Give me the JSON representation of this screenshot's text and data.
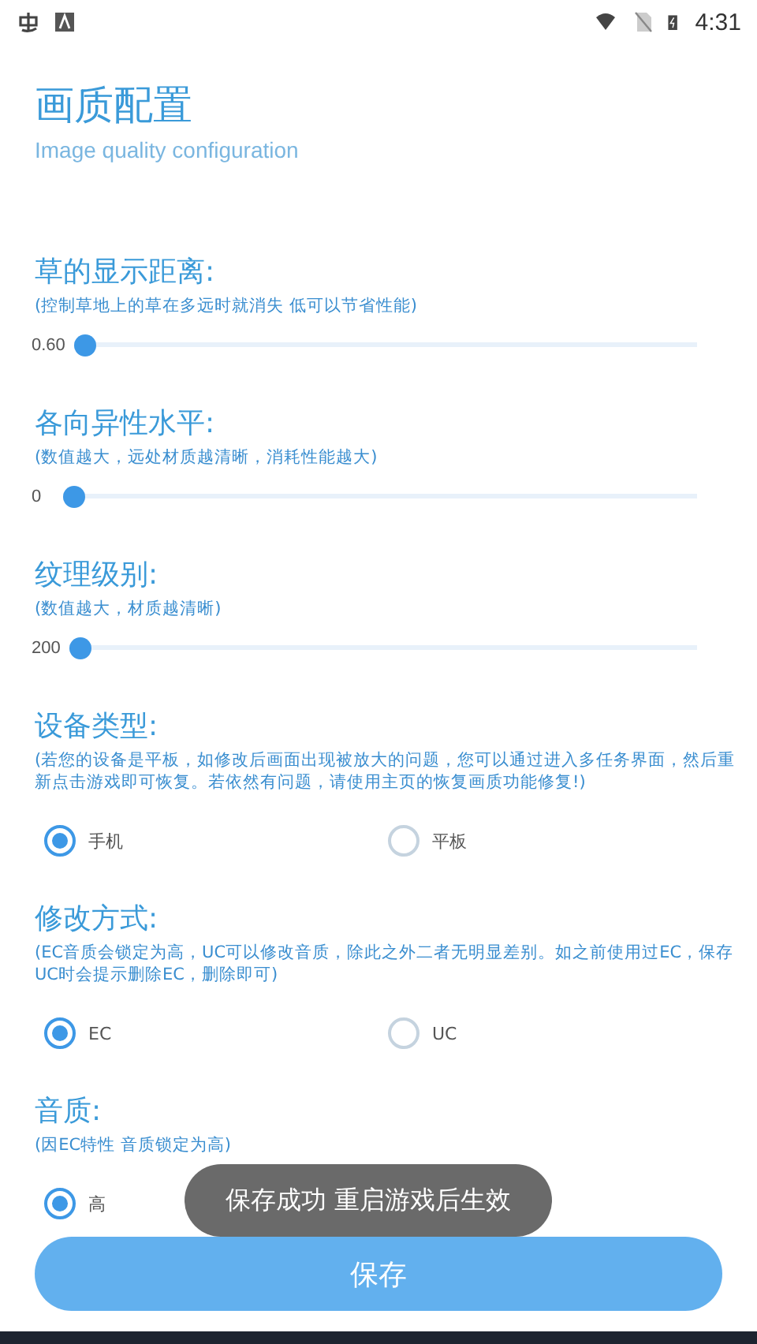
{
  "status_bar": {
    "time": "4:31"
  },
  "header": {
    "title": "画质配置",
    "subtitle": "Image quality configuration"
  },
  "sections": [
    {
      "kind": "slider",
      "title": "草的显示距离:",
      "hint": "(控制草地上的草在多远时就消失 低可以节省性能)",
      "reading": "0.60",
      "level": 0
    },
    {
      "kind": "slider",
      "title": "各向异性水平:",
      "hint": "(数值越大，远处材质越清晰，消耗性能越大)",
      "reading": "0",
      "level": 0
    },
    {
      "kind": "slider",
      "title": "纹理级别:",
      "hint": "(数值越大，材质越清晰)",
      "reading": "200",
      "level": 0
    },
    {
      "kind": "radio",
      "title": "设备类型:",
      "hint": "(若您的设备是平板，如修改后画面出现被放大的问题，您可以通过进入多任务界面，然后重新点击游戏即可恢复。若依然有问题，请使用主页的恢复画质功能修复!)",
      "options": [
        {
          "label": "手机",
          "selected": true
        },
        {
          "label": "平板",
          "selected": false
        }
      ]
    },
    {
      "kind": "radio",
      "title": "修改方式:",
      "hint": "(EC音质会锁定为高，UC可以修改音质，除此之外二者无明显差别。如之前使用过EC，保存UC时会提示删除EC，删除即可)",
      "options": [
        {
          "label": "EC",
          "selected": true
        },
        {
          "label": "UC",
          "selected": false
        }
      ]
    },
    {
      "kind": "radio",
      "title": "音质:",
      "hint": "(因EC特性 音质锁定为高)",
      "options": [
        {
          "label": "高",
          "selected": true
        }
      ]
    }
  ],
  "save_button": "保存",
  "toast": "保存成功 重启游戏后生效"
}
